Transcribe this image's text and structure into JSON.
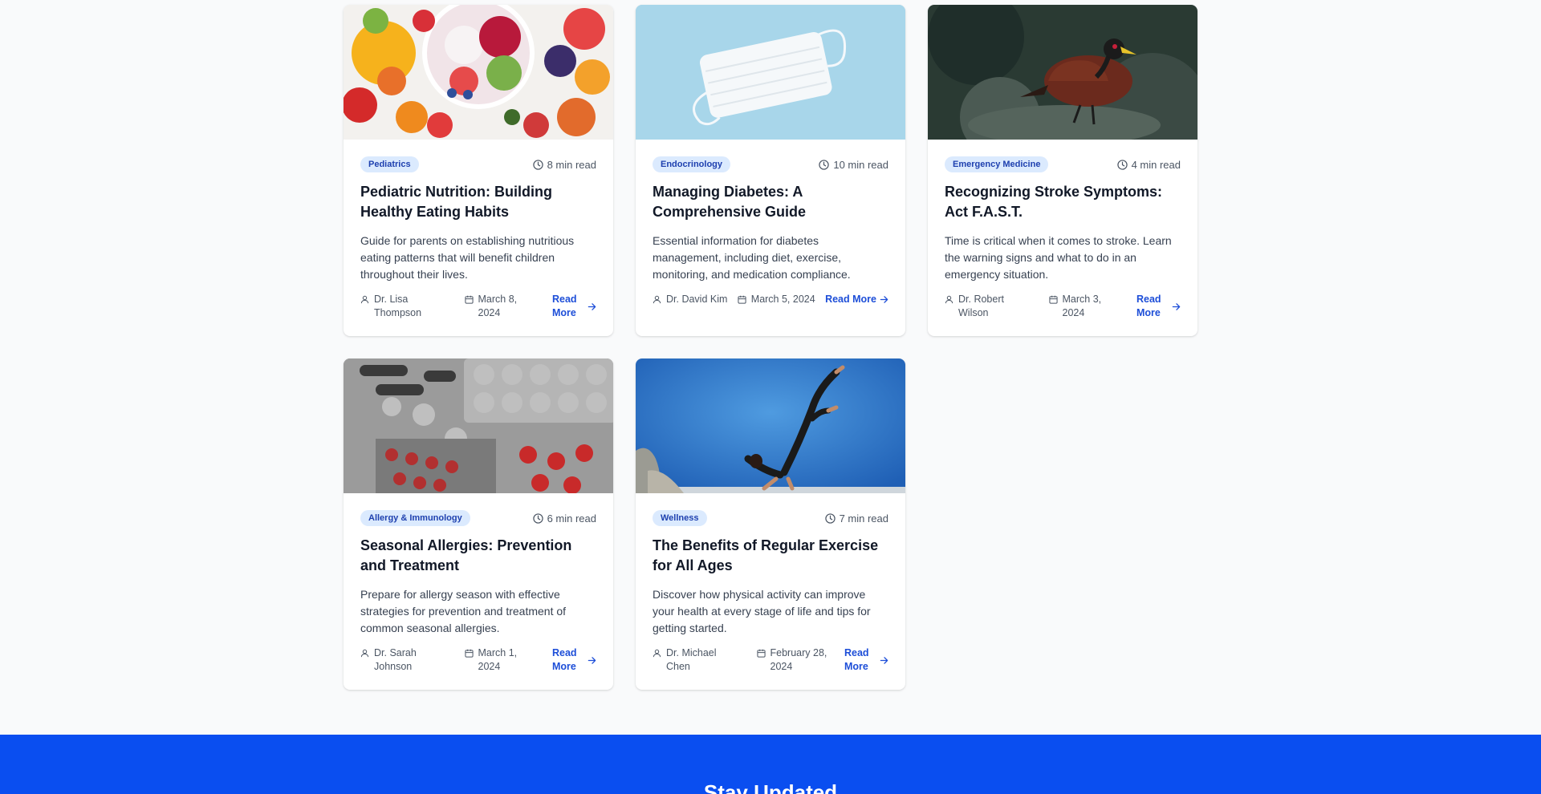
{
  "articles": [
    {
      "category": "Pediatrics",
      "read_time": "8 min read",
      "title": "Pediatric Nutrition: Building Healthy Eating Habits",
      "excerpt": "Guide for parents on establishing nutritious eating patterns that will benefit children throughout their lives.",
      "author": "Dr. Lisa Thompson",
      "date": "March 8, 2024",
      "read_more": "Read More",
      "image_icon": "fruit-bowl-image"
    },
    {
      "category": "Endocrinology",
      "read_time": "10 min read",
      "title": "Managing Diabetes: A Comprehensive Guide",
      "excerpt": "Essential information for diabetes management, including diet, exercise, monitoring, and medication compliance.",
      "author": "Dr. David Kim",
      "date": "March 5, 2024",
      "read_more": "Read More",
      "image_icon": "face-mask-image"
    },
    {
      "category": "Emergency Medicine",
      "read_time": "4 min read",
      "title": "Recognizing Stroke Symptoms: Act F.A.S.T.",
      "excerpt": "Time is critical when it comes to stroke. Learn the warning signs and what to do in an emergency situation.",
      "author": "Dr. Robert Wilson",
      "date": "March 3, 2024",
      "read_more": "Read More",
      "image_icon": "bird-image"
    },
    {
      "category": "Allergy & Immunology",
      "read_time": "6 min read",
      "title": "Seasonal Allergies: Prevention and Treatment",
      "excerpt": "Prepare for allergy season with effective strategies for prevention and treatment of common seasonal allergies.",
      "author": "Dr. Sarah Johnson",
      "date": "March 1, 2024",
      "read_more": "Read More",
      "image_icon": "pills-image"
    },
    {
      "category": "Wellness",
      "read_time": "7 min read",
      "title": "The Benefits of Regular Exercise for All Ages",
      "excerpt": "Discover how physical activity can improve your health at every stage of life and tips for getting started.",
      "author": "Dr. Michael Chen",
      "date": "February 28, 2024",
      "read_more": "Read More",
      "image_icon": "yoga-image"
    }
  ],
  "newsletter": {
    "title": "Stay Updated"
  },
  "colors": {
    "accent": "#1d4ed8",
    "badge_bg": "#dbeafe",
    "badge_text": "#1e40af",
    "newsletter_bg": "#0a4ef0"
  }
}
